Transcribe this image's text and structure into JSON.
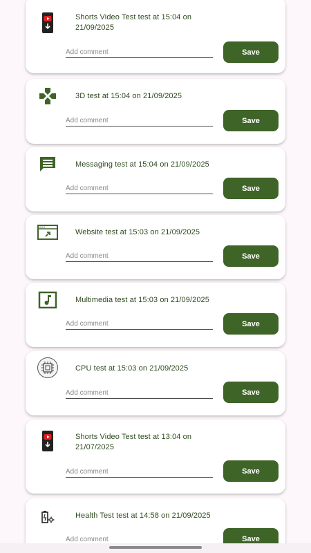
{
  "results": [
    {
      "icon": "phone-video-icon",
      "title": "Shorts Video Test test at 15:04 on 21/09/2025",
      "placeholder": "Add comment",
      "save_label": "Save"
    },
    {
      "icon": "gamepad-icon",
      "title": "3D test at 15:04 on 21/09/2025",
      "placeholder": "Add comment",
      "save_label": "Save"
    },
    {
      "icon": "message-icon",
      "title": "Messaging test at 15:04 on 21/09/2025",
      "placeholder": "Add comment",
      "save_label": "Save"
    },
    {
      "icon": "website-icon",
      "title": "Website test at 15:03 on 21/09/2025",
      "placeholder": "Add comment",
      "save_label": "Save"
    },
    {
      "icon": "music-note-icon",
      "title": "Multimedia test at 15:03 on 21/09/2025",
      "placeholder": "Add comment",
      "save_label": "Save"
    },
    {
      "icon": "cpu-chip-icon",
      "title": "CPU test at 15:03 on 21/09/2025",
      "placeholder": "Add comment",
      "save_label": "Save"
    },
    {
      "icon": "phone-video-icon",
      "title": "Shorts Video Test test at 13:04 on 21/07/2025",
      "placeholder": "Add comment",
      "save_label": "Save"
    },
    {
      "icon": "battery-gear-icon",
      "title": "Health Test test at 14:58 on 21/09/2025",
      "placeholder": "Add comment",
      "save_label": "Save"
    }
  ],
  "colors": {
    "accent": "#3e6428",
    "title_text": "#2d4a1e",
    "background": "#fdf7fb",
    "card": "#ffffff"
  }
}
